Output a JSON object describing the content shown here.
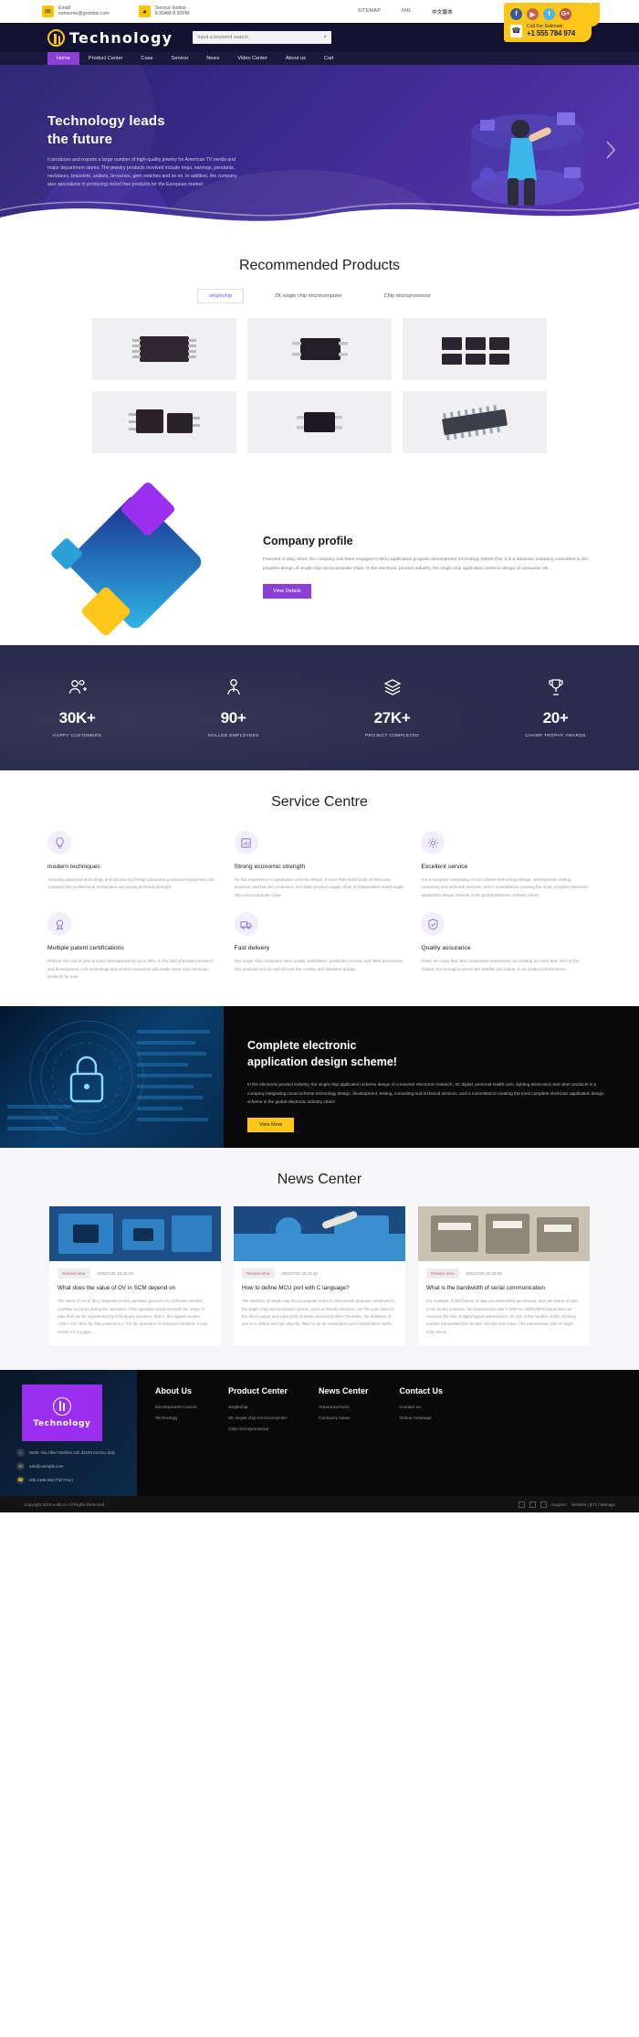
{
  "topbar": {
    "email_label": "Email",
    "email_value": "someone@growbiz.com",
    "hotline_label": "Service hotline",
    "hotline_value": "9:30AM-6:30PM",
    "links": [
      "SITEMAP",
      "XML"
    ],
    "lang": "中文版本",
    "mail_icon": "mail-icon",
    "clock_icon": "clock-icon"
  },
  "callcard": {
    "socials": [
      {
        "name": "facebook-icon",
        "glyph": "f"
      },
      {
        "name": "youtube-icon",
        "glyph": "▶"
      },
      {
        "name": "twitter-icon",
        "glyph": "t"
      },
      {
        "name": "googleplus-icon",
        "glyph": "G+"
      }
    ],
    "label": "Call For Estimate",
    "phone": "+1 555 784 974",
    "phone_icon": "phone-icon"
  },
  "header": {
    "logo_text": "Technology",
    "logo_icon": "technology-logo-icon",
    "search_placeholder": "Input a keyword search",
    "search_value": "",
    "search_icon": "search-icon"
  },
  "nav": {
    "items": [
      {
        "label": "Home",
        "active": true
      },
      {
        "label": "Product Center",
        "active": false
      },
      {
        "label": "Case",
        "active": false
      },
      {
        "label": "Service",
        "active": false
      },
      {
        "label": "News",
        "active": false
      },
      {
        "label": "Video Center",
        "active": false
      },
      {
        "label": "About us",
        "active": false
      },
      {
        "label": "Cart",
        "active": false
      }
    ]
  },
  "hero": {
    "title_line1": "Technology leads",
    "title_line2": "the future",
    "paragraph": "It produces and exports a large number of high-quality jewelry for American TV media and major department stores. The jewelry products involved include rings, earrings, pendants, necklaces, bracelets, anklets, brooches, gem watches and so on. In addition, the company also specializes in producing nickel free products for the European market.",
    "prev_icon": "chevron-left-icon",
    "next_icon": "chevron-right-icon"
  },
  "products": {
    "title": "Recommended Products",
    "tabs": [
      {
        "label": "singlechip",
        "active": true
      },
      {
        "label": "ZK single chip microcomputer",
        "active": false
      },
      {
        "label": "Chip microprocessor",
        "active": false
      }
    ],
    "items": [
      {
        "name": "product-chip-1"
      },
      {
        "name": "product-chip-2"
      },
      {
        "name": "product-chip-3"
      },
      {
        "name": "product-chip-4"
      },
      {
        "name": "product-chip-5"
      },
      {
        "name": "product-chip-6"
      }
    ]
  },
  "profile": {
    "title": "Company profile",
    "paragraph": "Founded in May, 2010, the company has been engaged in MCU application program development technology before that. It is a domestic company committed to the program design of single chip microcomputer chips. In the electronic product industry, the single chip application scheme design of consumer ele...",
    "button": "View Details"
  },
  "stats": [
    {
      "icon": "users-plus-icon",
      "glyph": "👥",
      "number": "30K+",
      "label": "HAPPY CUSTOMERS"
    },
    {
      "icon": "employee-icon",
      "glyph": "👤",
      "number": "90+",
      "label": "SKILLED EMPLOYEES"
    },
    {
      "icon": "layers-icon",
      "glyph": "◆",
      "number": "27K+",
      "label": "PROJECT COMPLETED"
    },
    {
      "icon": "trophy-icon",
      "glyph": "🏆",
      "number": "20+",
      "label": "CHAMP TROPHY AWARDS"
    }
  ],
  "services": {
    "title": "Service Centre",
    "cards": [
      {
        "icon": "lightbulb-icon",
        "glyph": "💡",
        "title": "modern techniques",
        "text": "Adopting advanced technology and introducing foreign advanced production equipment, the company has professional technicians and strong technical strength."
      },
      {
        "icon": "economy-icon",
        "glyph": "📊",
        "title": "Strong economic strength",
        "text": "He has experience in application scheme design of more than 5000 kinds of electronic products, and has the production and sales product supply chain of independent brand single chip microcomputer chips."
      },
      {
        "icon": "service-icon",
        "glyph": "⚙",
        "title": "Excellent service",
        "text": "It is a company integrating circuit scheme technology design, development, testing, consulting and technical services, and is committed to creating the most complete electronic application design scheme in the global electronic industry chain!"
      },
      {
        "icon": "patent-icon",
        "glyph": "🏅",
        "title": "Multiple patent certifications",
        "text": "Reduce the cost of your product development by up to 30%. In the field of product research and development, rich technology and product resources will create lower cost electronic products for you!"
      },
      {
        "icon": "delivery-icon",
        "glyph": "🚚",
        "title": "Fast delivery",
        "text": "Our single-chip computers have quality certification, production license and other procedures. Our products can be sold all over the country and delivered quickly."
      },
      {
        "icon": "quality-icon",
        "glyph": "✔",
        "title": "Quality assurance",
        "text": "There are more than 800 cooperative enterprises, accounting for more than 40% of the market. It is enough to prove the stability and safety of our product performance."
      }
    ]
  },
  "banner": {
    "title_line1": "Complete electronic",
    "title_line2": "application design scheme!",
    "paragraph": "In the electronic product industry, the single chip application scheme design of consumer electronic research, 3C digital, personal health care, lighting electronics and other products is a company integrating circuit scheme technology design, development, testing, consulting and technical services, and is committed to creating the most complete electronic application design scheme in the global electronic industry chain!",
    "button": "View More"
  },
  "news": {
    "title": "News Center",
    "items": [
      {
        "badge": "Release time:",
        "date": "2022/7/20 15:25:23",
        "title": "What does the value of OV in SCM depend on",
        "desc": "The value of OV in MCU depends on the operation process OV: indicates whether overflow occurred during the operation. If the operation result exceeds the range of data that can be represented by 8-bit binary numbers, that is, the signed number -128~+127, then the flag position is 1. For the operation of unsigned numbers, it only needs CY to judge, ..."
      },
      {
        "badge": "Release time:",
        "date": "2022/7/20 15:23:42",
        "title": "How to define MCU port with C language?",
        "desc": "The interface of single chip microcomputer refers to all external channels connected to the single chip microcomputer system, such as RS232 interface, etc.The port refers to the direct output and input ports of these microcontrollers.Therefore, the definition of port is to define each pin directly. Take 51 as an example:51 port classification metho..."
      },
      {
        "badge": "Release time:",
        "date": "2022/7/20 15:23:08",
        "title": "What is the bandwidth of serial communication",
        "desc": "For example, if 300 frames of data are transmitted per second, and one frame of data is ten binary numbers, the transmission rate is 300×10=3000 (BPS).Baud rate can measure the rate of digital signal transmission. Its size is the number of bits of binary number transmitted per second, and the unit is bps. The transmission rate of single chip microc..."
      }
    ]
  },
  "footer": {
    "logo_text": "Technology",
    "logo_icon": "technology-logo-icon",
    "contacts": [
      {
        "icon": "location-icon",
        "glyph": "⌂",
        "text": "Work: Via Alfieri Settimo 22b 32100 Arezzo, Italy"
      },
      {
        "icon": "email-icon",
        "glyph": "✉",
        "text": "ask@example.com"
      },
      {
        "icon": "phone-icon",
        "glyph": "☎",
        "text": "005 1698 558 (Toll Free)"
      }
    ],
    "columns": [
      {
        "heading": "About Us",
        "links": [
          "Development Course",
          "Technology"
        ]
      },
      {
        "heading": "Product Center",
        "links": [
          "singlechip",
          "ZK single chip microcomputer",
          "Chip microprocessor"
        ]
      },
      {
        "heading": "News Center",
        "links": [
          "Announcement",
          "Company News"
        ]
      },
      {
        "heading": "Contact Us",
        "links": [
          "Contact us",
          "Online message"
        ]
      }
    ],
    "copyright": "Copyright 2019 a-idb.cn All Rights Reserved.",
    "support_label": "Support:",
    "support_links": "Website | jk71 | Manage"
  },
  "colors": {
    "accent_yellow": "#ffc61a",
    "accent_purple": "#8b3fd6",
    "dark_navy": "#131331",
    "stats_bg": "#2b2b4d"
  }
}
